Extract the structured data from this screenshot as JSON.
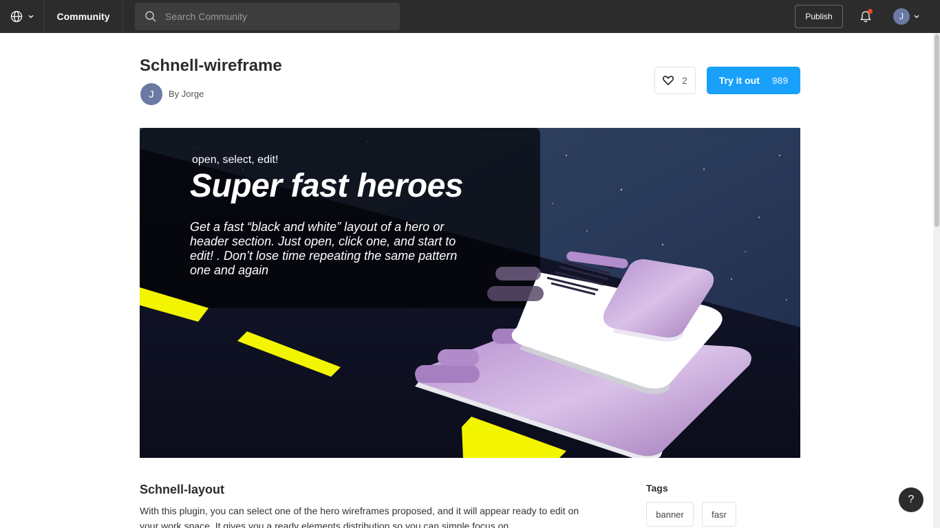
{
  "topbar": {
    "community_label": "Community",
    "search_placeholder": "Search Community",
    "publish_label": "Publish",
    "user_initial": "J"
  },
  "resource": {
    "title": "Schnell-wireframe",
    "author_initial": "J",
    "author_line": "By Jorge",
    "likes": "2",
    "try_label": "Try it out",
    "try_count": "989"
  },
  "hero": {
    "eyebrow": "open, select, edit!",
    "headline": "Super fast heroes",
    "body": "Get a fast “black and white” layout of a hero or header section. Just open, click one, and start to edit! . Don’t lose time repeating the same pattern one and again"
  },
  "description": {
    "title": "Schnell-layout",
    "body": "With this plugin, you can select one of the hero wireframes proposed, and it will appear ready to edit on your work space. It gives you a ready elements distribution so you can simple focus on"
  },
  "tags": {
    "title": "Tags",
    "items": [
      "banner",
      "fasr"
    ]
  },
  "help_label": "?",
  "colors": {
    "topbar": "#2c2c2c",
    "accent": "#18a0fb",
    "hero_purple": "#a97fc0",
    "hero_yellow": "#f3f500"
  }
}
